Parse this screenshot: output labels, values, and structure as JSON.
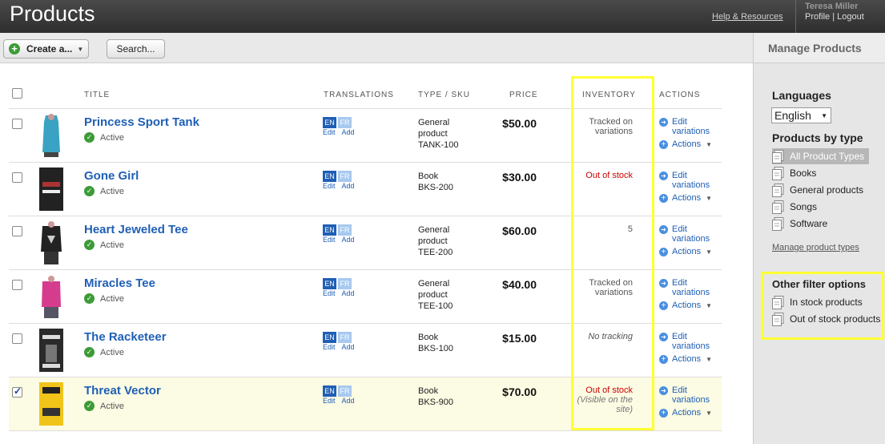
{
  "header": {
    "title": "Products",
    "help_link": "Help & Resources",
    "user_name": "Teresa Miller",
    "profile_link": "Profile",
    "separator": "|",
    "logout_link": "Logout"
  },
  "toolbar": {
    "create_label": "Create a...",
    "search_label": "Search..."
  },
  "columns": {
    "title": "TITLE",
    "translations": "TRANSLATIONS",
    "type_sku": "TYPE / SKU",
    "price": "PRICE",
    "inventory": "INVENTORY",
    "actions": "ACTIONS"
  },
  "row_labels": {
    "active": "Active",
    "en": "EN",
    "fr": "FR",
    "edit": "Edit",
    "add": "Add",
    "edit_variations_1": "Edit",
    "edit_variations_2": "variations",
    "actions": "Actions"
  },
  "products": [
    {
      "title": "Princess Sport Tank",
      "type1": "General",
      "type2": "product",
      "sku": "TANK-100",
      "price": "$50.00",
      "inv1": "Tracked on",
      "inv2": "variations",
      "inv3": "",
      "checked": false
    },
    {
      "title": "Gone Girl",
      "type1": "Book",
      "type2": "",
      "sku": "BKS-200",
      "price": "$30.00",
      "inv1": "Out of stock",
      "inv2": "",
      "inv3": "",
      "checked": false
    },
    {
      "title": "Heart Jeweled Tee",
      "type1": "General",
      "type2": "product",
      "sku": "TEE-200",
      "price": "$60.00",
      "inv1": "5",
      "inv2": "",
      "inv3": "",
      "checked": false
    },
    {
      "title": "Miracles Tee",
      "type1": "General",
      "type2": "product",
      "sku": "TEE-100",
      "price": "$40.00",
      "inv1": "Tracked on",
      "inv2": "variations",
      "inv3": "",
      "checked": false
    },
    {
      "title": "The Racketeer",
      "type1": "Book",
      "type2": "",
      "sku": "BKS-100",
      "price": "$15.00",
      "inv1": "No tracking",
      "inv2": "",
      "inv3": "",
      "checked": false
    },
    {
      "title": "Threat Vector",
      "type1": "Book",
      "type2": "",
      "sku": "BKS-900",
      "price": "$70.00",
      "inv1": "Out of stock",
      "inv2": "(Visible on the",
      "inv3": "site)",
      "checked": true
    }
  ],
  "sidebar": {
    "heading": "Manage Products",
    "languages_title": "Languages",
    "language_selected": "English",
    "types_title": "Products by type",
    "types": [
      "All Product Types",
      "Books",
      "General products",
      "Songs",
      "Software"
    ],
    "manage_types": "Manage product types",
    "other_title": "Other filter options",
    "other": [
      "In stock products",
      "Out of stock products"
    ]
  },
  "colors": {
    "link_blue": "#1f5fb5",
    "highlight_yellow": "#ffff33",
    "out_of_stock_red": "#cc0000",
    "active_green": "#3d9b37"
  }
}
